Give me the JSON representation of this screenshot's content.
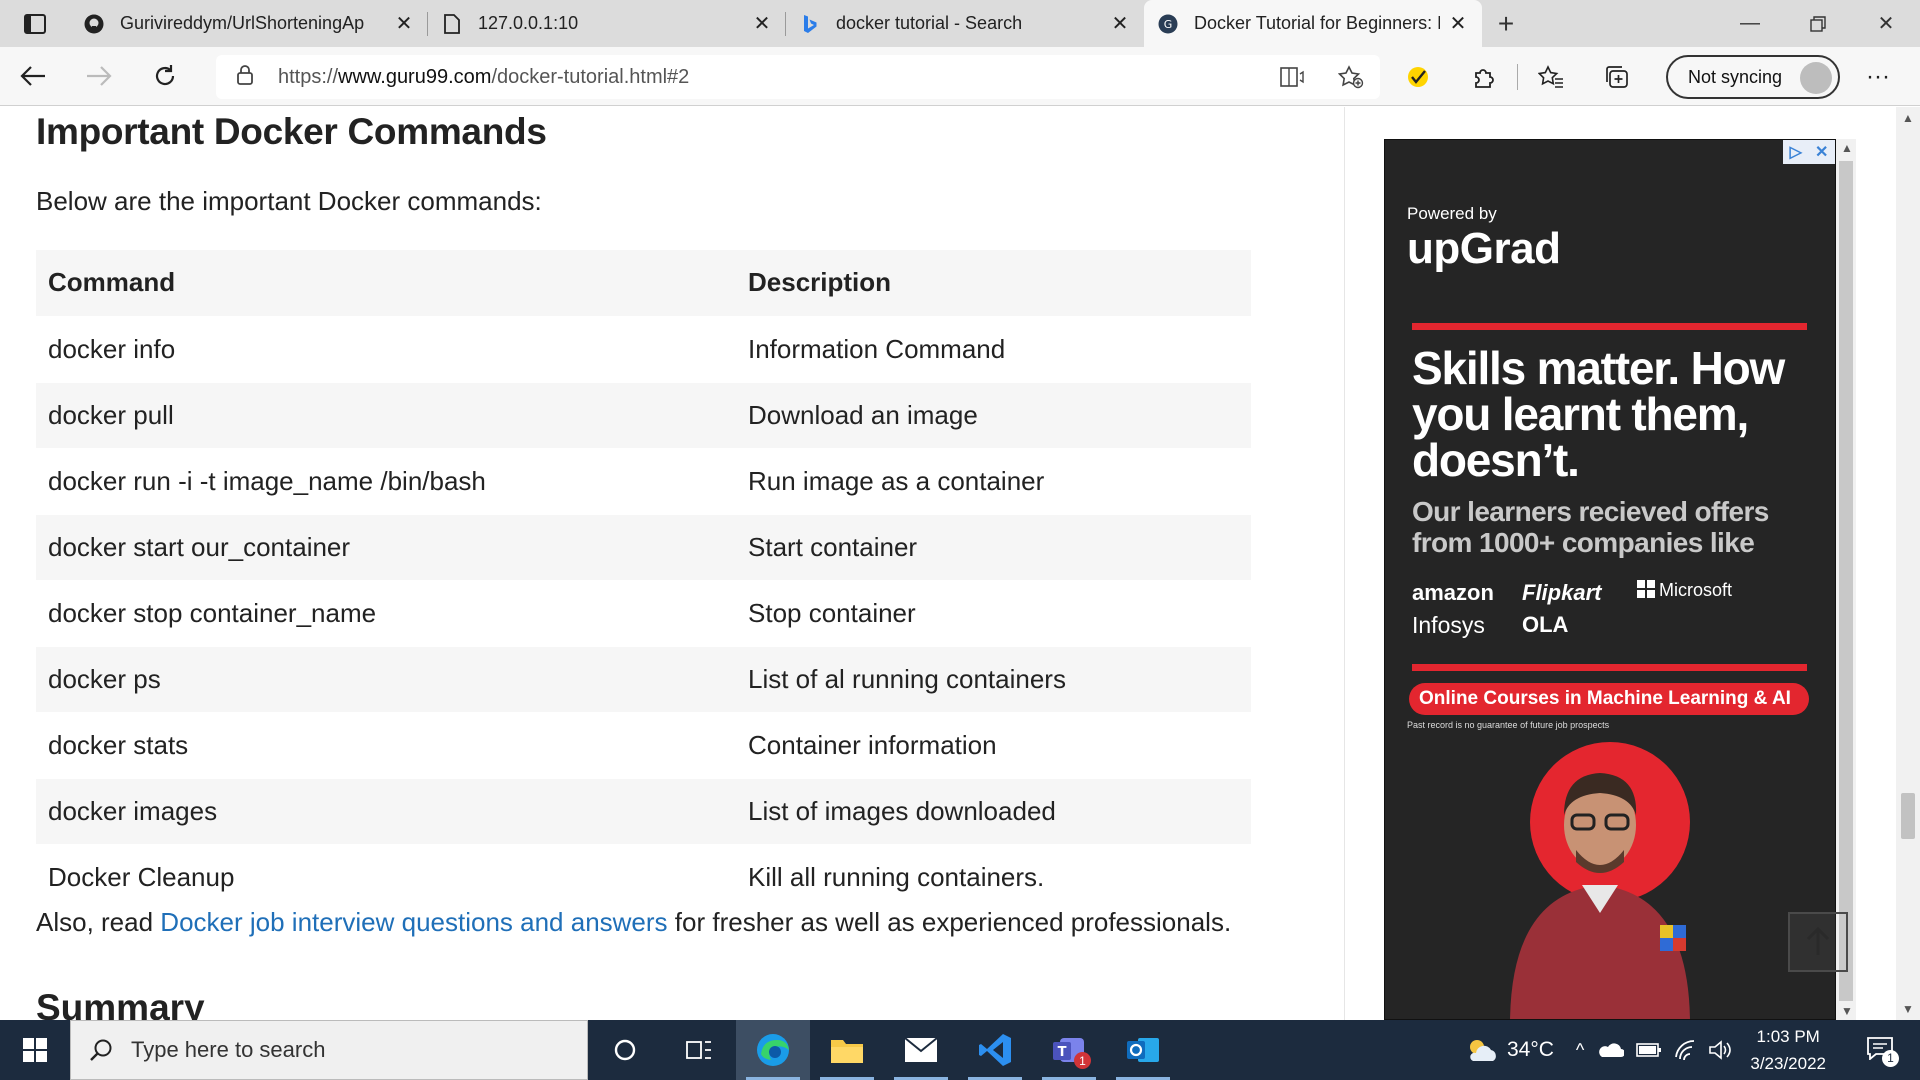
{
  "browser": {
    "tabs": [
      {
        "title": "Gurivireddym/UrlShorteningAp",
        "icon": "github-icon"
      },
      {
        "title": "127.0.0.1:10",
        "icon": "document-icon"
      },
      {
        "title": "docker tutorial - Search",
        "icon": "bing-icon"
      },
      {
        "title": "Docker Tutorial for Beginners: Ba",
        "icon": "guru99-icon",
        "active": true
      }
    ],
    "url_prefix": "https://",
    "url_host": "www.guru99.com",
    "url_path": "/docker-tutorial.html#2",
    "sync_label": "Not syncing"
  },
  "article": {
    "heading": "Important Docker Commands",
    "intro": "Below are the important Docker commands:",
    "table": {
      "headers": [
        "Command",
        "Description"
      ],
      "rows": [
        [
          "docker info",
          "Information Command"
        ],
        [
          "docker pull",
          "Download an image"
        ],
        [
          "docker run -i -t image_name /bin/bash",
          "Run image as a container"
        ],
        [
          "docker start our_container",
          "Start container"
        ],
        [
          "docker stop container_name",
          "Stop container"
        ],
        [
          "docker ps",
          "List of al running containers"
        ],
        [
          "docker stats",
          "Container information"
        ],
        [
          "docker images",
          "List of images downloaded"
        ],
        [
          "Docker Cleanup",
          "Kill all running containers."
        ]
      ]
    },
    "also_prefix": "Also, read ",
    "also_link": "Docker job interview questions and answers",
    "also_suffix": " for fresher as well as experienced professionals.",
    "next_heading": "Summary"
  },
  "ad": {
    "powered_by": "Powered by",
    "brand": "upGrad",
    "headline": "Skills matter. How you learnt them, doesn’t.",
    "sub": "Our learners recieved offers from 1000+ companies like",
    "companies": [
      "amazon",
      "Flipkart",
      "Microsoft",
      "Infosys",
      "OLA"
    ],
    "cta": "Online Courses in Machine Learning & AI",
    "fine_print": "Past record is no guarantee of future job prospects",
    "accent_color": "#e3262f"
  },
  "taskbar": {
    "search_placeholder": "Type here to search",
    "teams_badge": "1",
    "temperature": "34°C",
    "time": "1:03 PM",
    "date": "3/23/2022",
    "notification_count": "1"
  }
}
